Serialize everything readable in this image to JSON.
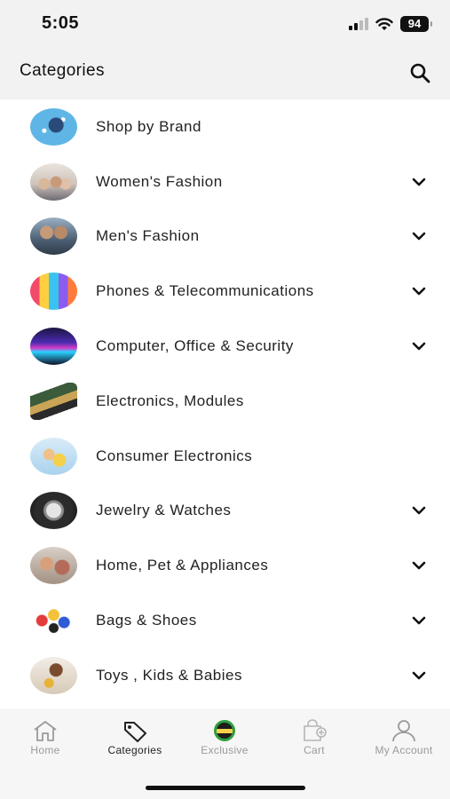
{
  "status_bar": {
    "time": "5:05",
    "battery": "94"
  },
  "header": {
    "title": "Categories"
  },
  "categories": [
    {
      "label": "Shop by Brand",
      "expandable": false
    },
    {
      "label": "Women's Fashion",
      "expandable": true
    },
    {
      "label": "Men's Fashion",
      "expandable": true
    },
    {
      "label": "Phones & Telecommunications",
      "expandable": true
    },
    {
      "label": "Computer, Office & Security",
      "expandable": true
    },
    {
      "label": "Electronics, Modules",
      "expandable": false
    },
    {
      "label": "Consumer Electronics",
      "expandable": false
    },
    {
      "label": "Jewelry & Watches",
      "expandable": true
    },
    {
      "label": "Home, Pet & Appliances",
      "expandable": true
    },
    {
      "label": "Bags & Shoes",
      "expandable": true
    },
    {
      "label": "Toys , Kids & Babies",
      "expandable": true
    }
  ],
  "tabbar": {
    "home": "Home",
    "categories": "Categories",
    "exclusive": "Exclusive",
    "cart": "Cart",
    "account": "My Account",
    "active": "categories"
  },
  "colors": {
    "accent_green": "#2e9e3e",
    "inactive_gray": "#9a9a9a"
  }
}
